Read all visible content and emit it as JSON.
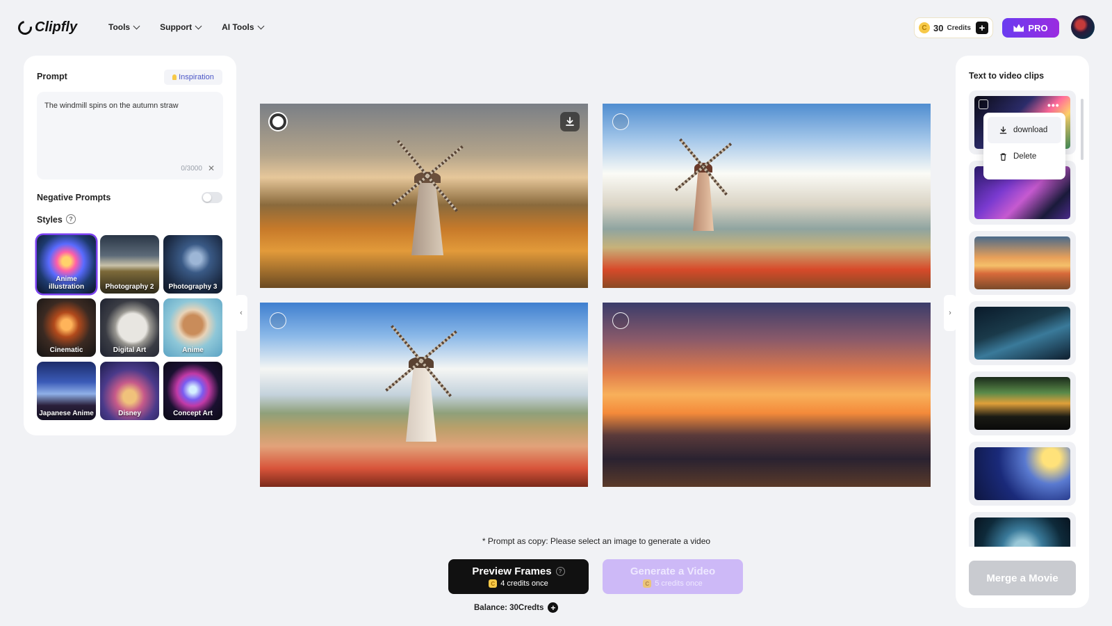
{
  "header": {
    "logo": "Clipfly",
    "nav": [
      {
        "label": "Tools"
      },
      {
        "label": "Support"
      },
      {
        "label": "AI Tools"
      }
    ],
    "credits": {
      "amount": "30",
      "label": "Credits",
      "coin": "C"
    },
    "pro_label": "PRO"
  },
  "prompt_panel": {
    "title": "Prompt",
    "inspiration_label": "Inspiration",
    "prompt_text": "The windmill spins on the autumn straw",
    "counter": "0/3000",
    "negative_label": "Negative Prompts",
    "negative_enabled": false,
    "styles_label": "Styles",
    "styles": [
      {
        "name": "Anime illustration",
        "selected": true
      },
      {
        "name": "Photography 2",
        "selected": false
      },
      {
        "name": "Photography 3",
        "selected": false
      },
      {
        "name": "Cinematic",
        "selected": false
      },
      {
        "name": "Digital Art",
        "selected": false
      },
      {
        "name": "Anime",
        "selected": false
      },
      {
        "name": "Japanese Anime",
        "selected": false
      },
      {
        "name": "Disney",
        "selected": false
      },
      {
        "name": "Concept Art",
        "selected": false
      }
    ]
  },
  "gallery": {
    "images": [
      {
        "selected": true,
        "scene": "autumn windmill"
      },
      {
        "selected": false,
        "scene": "windmill by river"
      },
      {
        "selected": false,
        "scene": "windmill on hill"
      },
      {
        "selected": false,
        "scene": "sunset palms"
      }
    ]
  },
  "actions": {
    "note": "* Prompt as copy: Please select an image to generate a video",
    "preview_title": "Preview Frames",
    "preview_sub": "4 credits once",
    "generate_title": "Generate a Video",
    "generate_sub": "5 credits once",
    "balance": "Balance: 30Credts",
    "coin": "C"
  },
  "clips_panel": {
    "title": "Text to video clips",
    "menu": {
      "download": "download",
      "delete": "Delete"
    },
    "merge_label": "Merge a Movie",
    "dots": "•••"
  },
  "colors": {
    "accent": "#7a3ff0",
    "pro_gradient_start": "#6a3cf0",
    "generate_disabled": "#cdb9f7"
  }
}
